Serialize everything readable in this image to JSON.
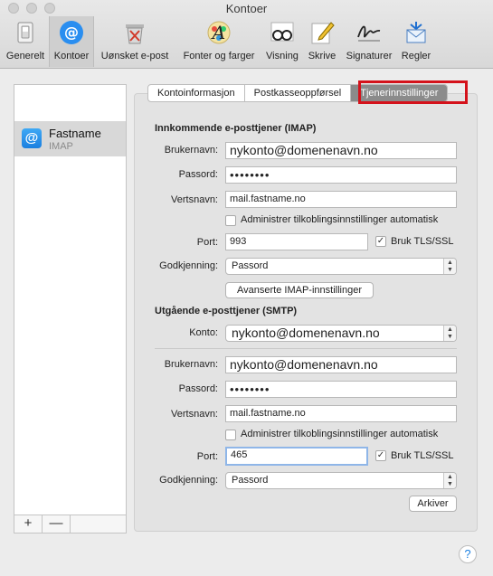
{
  "window": {
    "title": "Kontoer"
  },
  "toolbar": {
    "items": [
      {
        "label": "Generelt",
        "icon": "switch-icon"
      },
      {
        "label": "Kontoer",
        "icon": "at-sign-icon"
      },
      {
        "label": "Uønsket e-post",
        "icon": "junk-mail-icon"
      },
      {
        "label": "Fonter og farger",
        "icon": "fonts-colors-icon"
      },
      {
        "label": "Visning",
        "icon": "glasses-icon"
      },
      {
        "label": "Skrive",
        "icon": "compose-icon"
      },
      {
        "label": "Signaturer",
        "icon": "signature-icon"
      },
      {
        "label": "Regler",
        "icon": "rules-icon"
      }
    ],
    "active_index": 1
  },
  "accounts": {
    "items": [
      {
        "name": "Fastname",
        "type": "IMAP",
        "icon_glyph": "@"
      }
    ],
    "add_glyph": "+",
    "remove_glyph": "—"
  },
  "tabs": [
    "Kontoinformasjon",
    "Postkasseoppførsel",
    "Tjenerinnstillinger"
  ],
  "selected_tab": "Tjenerinnstillinger",
  "incoming": {
    "title": "Innkommende e-posttjener (IMAP)",
    "username_label": "Brukernavn:",
    "username": "nykonto@domenenavn.no",
    "password_label": "Passord:",
    "password": "••••••••",
    "host_label": "Vertsnavn:",
    "host": "mail.fastname.no",
    "auto_manage_label": "Administrer tilkoblingsinnstillinger automatisk",
    "auto_manage_checked": false,
    "port_label": "Port:",
    "port": "993",
    "tls_label": "Bruk TLS/SSL",
    "tls_checked": true,
    "auth_label": "Godkjenning:",
    "auth": "Passord",
    "advanced_button": "Avanserte IMAP-innstillinger"
  },
  "outgoing": {
    "title": "Utgående e-posttjener (SMTP)",
    "account_label": "Konto:",
    "account": "nykonto@domenenavn.no",
    "username_label": "Brukernavn:",
    "username": "nykonto@domenenavn.no",
    "password_label": "Passord:",
    "password": "••••••••",
    "host_label": "Vertsnavn:",
    "host": "mail.fastname.no",
    "auto_manage_label": "Administrer tilkoblingsinnstillinger automatisk",
    "auto_manage_checked": false,
    "port_label": "Port:",
    "port": "465",
    "tls_label": "Bruk TLS/SSL",
    "tls_checked": true,
    "auth_label": "Godkjenning:",
    "auth": "Passord"
  },
  "save_button": "Arkiver",
  "help_glyph": "?",
  "check_glyph": "✓",
  "colors": {
    "accent": "#1b7fe0",
    "highlight": "#d4121b",
    "selected_tab": "#8b8b8b"
  }
}
